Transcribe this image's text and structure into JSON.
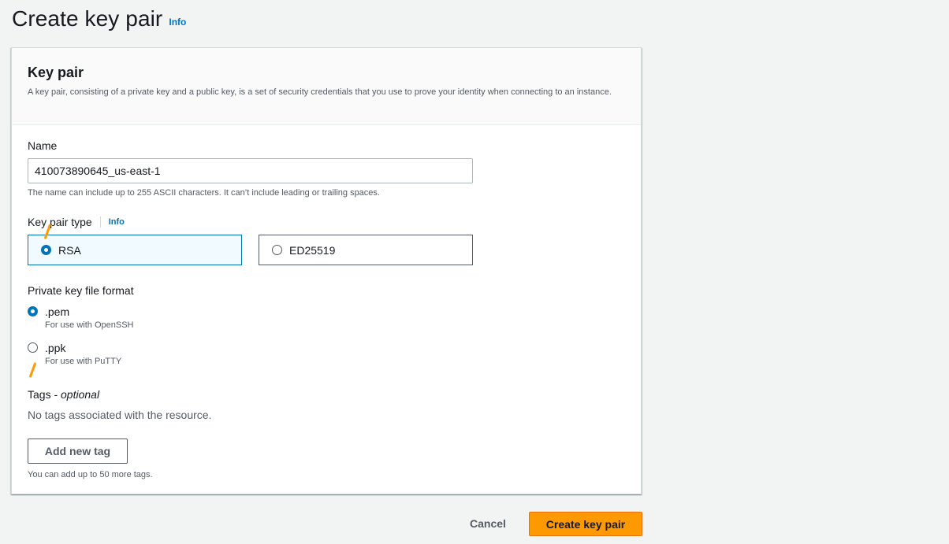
{
  "page": {
    "title": "Create key pair",
    "info_label": "Info"
  },
  "panel": {
    "title": "Key pair",
    "description": "A key pair, consisting of a private key and a public key, is a set of security credentials that you use to prove your identity when connecting to an instance."
  },
  "name_field": {
    "label": "Name",
    "value": "410073890645_us-east-1",
    "constraint": "The name can include up to 255 ASCII characters. It can’t include leading or trailing spaces."
  },
  "key_type": {
    "label": "Key pair type",
    "info_label": "Info",
    "options": [
      {
        "label": "RSA",
        "selected": true
      },
      {
        "label": "ED25519",
        "selected": false
      }
    ]
  },
  "file_format": {
    "label": "Private key file format",
    "options": [
      {
        "label": ".pem",
        "description": "For use with OpenSSH",
        "selected": true
      },
      {
        "label": ".ppk",
        "description": "For use with PuTTY",
        "selected": false
      }
    ]
  },
  "tags": {
    "label": "Tags - ",
    "label_optional": "optional",
    "empty_text": "No tags associated with the resource.",
    "add_button": "Add new tag",
    "limit_text": "You can add up to 50 more tags."
  },
  "actions": {
    "cancel": "Cancel",
    "create": "Create key pair"
  },
  "colors": {
    "primary_button": "#ff9900",
    "link": "#0073bb",
    "selected_tile_bg": "#f1faff"
  }
}
